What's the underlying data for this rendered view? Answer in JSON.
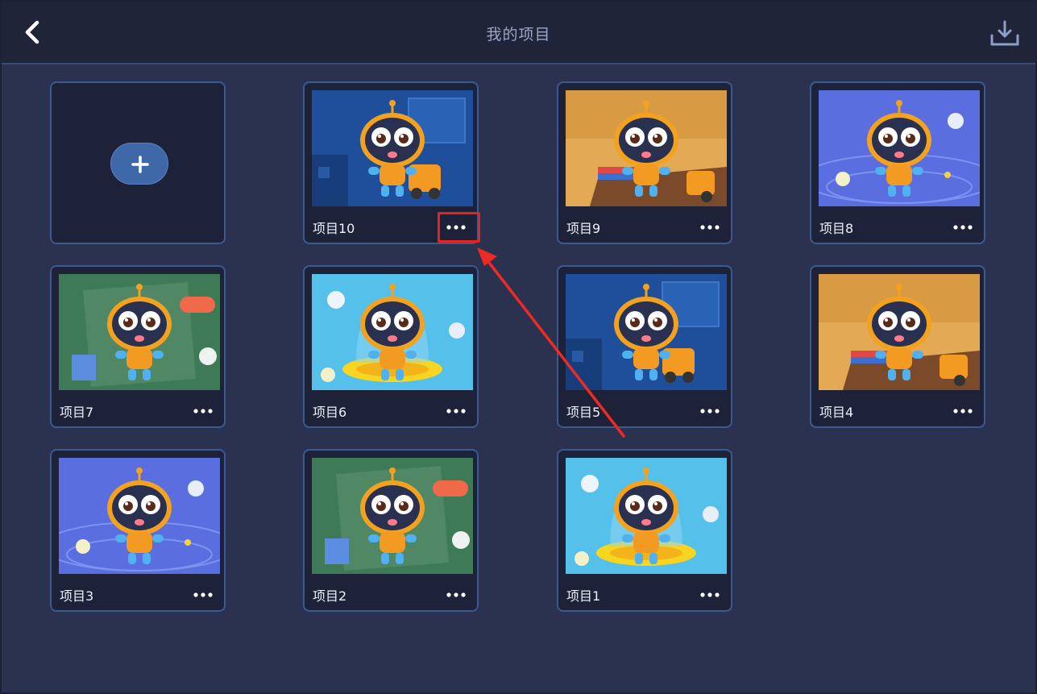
{
  "header": {
    "title": "我的项目",
    "back_icon": "chevron-left-icon",
    "download_icon": "download-icon"
  },
  "add_project": {
    "icon": "plus-icon"
  },
  "projects": [
    {
      "name": "项目10",
      "theme": "blue-room"
    },
    {
      "name": "项目9",
      "theme": "yellow-desk"
    },
    {
      "name": "项目8",
      "theme": "space-blue"
    },
    {
      "name": "项目7",
      "theme": "green-board"
    },
    {
      "name": "项目6",
      "theme": "ufo-light"
    },
    {
      "name": "项目5",
      "theme": "blue-room"
    },
    {
      "name": "项目4",
      "theme": "yellow-desk"
    },
    {
      "name": "项目3",
      "theme": "space-blue"
    },
    {
      "name": "项目2",
      "theme": "green-board"
    },
    {
      "name": "项目1",
      "theme": "ufo-light"
    }
  ],
  "more_icon": "more-horizontal-icon",
  "colors": {
    "background": "#2b3250",
    "header": "#1f2438",
    "card_border": "#3a5a90",
    "highlight": "#e8231d"
  }
}
